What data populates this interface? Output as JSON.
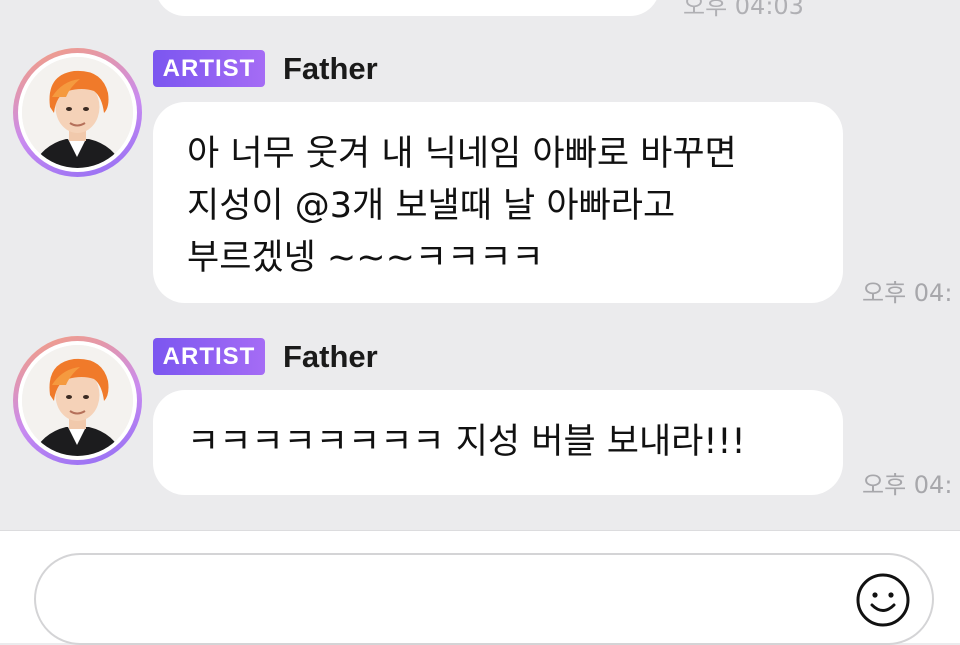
{
  "previous_message": {
    "time": "오후 04:03"
  },
  "messages": [
    {
      "badge": "ARTIST",
      "sender": "Father",
      "lines": [
        "아 너무 웃겨 내 닉네임 아빠로 바꾸면",
        "지성이 @3개 보낼때 날 아빠라고",
        "부르겠넹 ~~~ㅋㅋㅋㅋ"
      ],
      "time": "오후 04:"
    },
    {
      "badge": "ARTIST",
      "sender": "Father",
      "lines": [
        "ㅋㅋㅋㅋㅋㅋㅋㅋ 지성 버블 보내라!!!"
      ],
      "time": "오후 04:"
    }
  ],
  "input": {
    "value": "",
    "placeholder": ""
  },
  "icons": {
    "emoji": "smiley-face-icon"
  },
  "colors": {
    "background": "#ebebed",
    "bubble": "#ffffff",
    "badge_start": "#7b56f0",
    "badge_end": "#a56cf5",
    "timestamp": "#a7a7ab"
  }
}
